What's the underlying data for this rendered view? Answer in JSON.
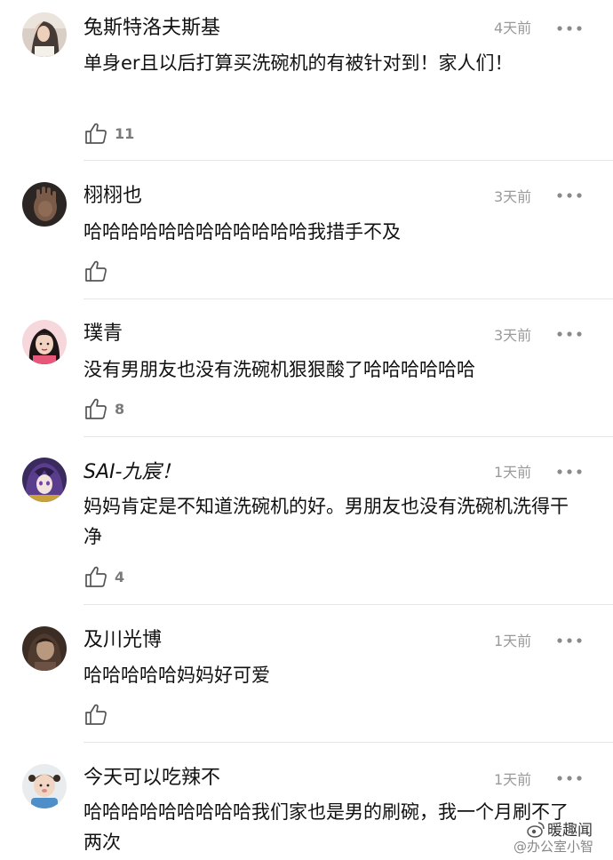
{
  "comments": [
    {
      "user": "兔斯特洛夫斯基",
      "time": "4天前",
      "text": "单身er且以后打算买洗碗机的有被针对到！家人们！",
      "likes": "11",
      "avatar_icon": "avatar-woman-dark-hair"
    },
    {
      "user": "栩栩也",
      "time": "3天前",
      "text": "哈哈哈哈哈哈哈哈哈哈哈哈我措手不及",
      "likes": "",
      "avatar_icon": "avatar-dark-hand"
    },
    {
      "user": "璞青",
      "time": "3天前",
      "text": "没有男朋友也没有洗碗机狠狠酸了哈哈哈哈哈哈",
      "likes": "8",
      "avatar_icon": "avatar-girl-pink"
    },
    {
      "user": "SAI-九宸！",
      "time": "1天前",
      "text": "妈妈肯定是不知道洗碗机的好。男朋友也没有洗碗机洗得干净",
      "likes": "4",
      "avatar_icon": "avatar-anime-purple"
    },
    {
      "user": "及川光博",
      "time": "1天前",
      "text": "哈哈哈哈哈妈妈好可爱",
      "likes": "",
      "avatar_icon": "avatar-sepia-portrait"
    },
    {
      "user": "今天可以吃辣不",
      "time": "1天前",
      "text": "哈哈哈哈哈哈哈哈哈我们家也是男的刷碗，我一个月刷不了两次",
      "likes": "",
      "avatar_icon": "avatar-child-blue"
    }
  ],
  "watermark": {
    "brand": "暖趣闻",
    "account": "@办公室小智"
  }
}
